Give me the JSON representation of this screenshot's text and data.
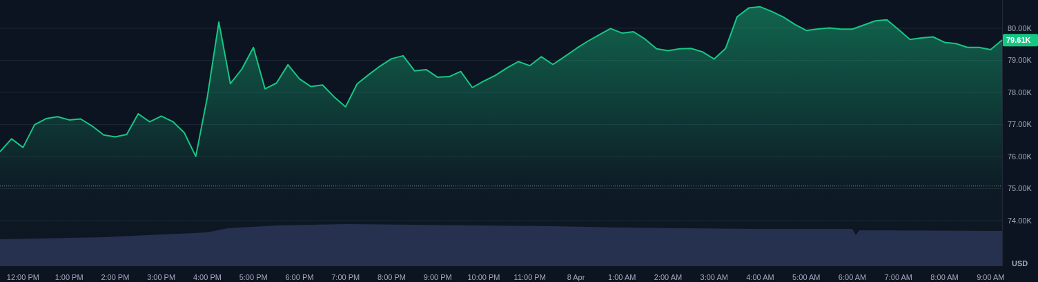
{
  "chart": {
    "chart_data": {
      "type": "area",
      "categories": [
        null,
        null,
        "12:00 PM",
        null,
        null,
        null,
        "1:00 PM",
        null,
        null,
        null,
        "2:00 PM",
        null,
        null,
        null,
        "3:00 PM",
        null,
        null,
        null,
        "4:00 PM",
        null,
        null,
        null,
        "5:00 PM",
        null,
        null,
        null,
        "6:00 PM",
        null,
        null,
        null,
        "7:00 PM",
        null,
        null,
        null,
        "8:00 PM",
        null,
        null,
        null,
        "9:00 PM",
        null,
        null,
        null,
        "10:00 PM",
        null,
        null,
        null,
        "11:00 PM",
        null,
        null,
        null,
        "8 Apr",
        null,
        null,
        null,
        "1:00 AM",
        null,
        null,
        null,
        "2:00 AM",
        null,
        null,
        null,
        "3:00 AM",
        null,
        null,
        null,
        "4:00 AM",
        null,
        null,
        null,
        "5:00 AM",
        null,
        null,
        null,
        "6:00 AM",
        null,
        null,
        null,
        "7:00 AM",
        null,
        null,
        null,
        "8:00 AM",
        null,
        null,
        null,
        "9:00 AM",
        null
      ],
      "series": [
        {
          "color": "#16c784",
          "values": [
            76.15,
            76.55,
            76.28,
            76.99,
            77.18,
            77.24,
            77.14,
            77.17,
            76.95,
            76.67,
            76.61,
            76.69,
            77.33,
            77.08,
            77.26,
            77.09,
            76.74,
            76.0,
            77.85,
            80.19,
            78.27,
            78.73,
            79.4,
            78.11,
            78.29,
            78.86,
            78.42,
            78.18,
            78.23,
            77.86,
            77.55,
            78.26,
            78.55,
            78.82,
            79.05,
            79.14,
            78.67,
            78.71,
            78.47,
            78.49,
            78.65,
            78.15,
            78.35,
            78.53,
            78.76,
            78.96,
            78.83,
            79.11,
            78.87,
            79.11,
            79.36,
            79.59,
            79.79,
            79.99,
            79.85,
            79.89,
            79.66,
            79.36,
            79.3,
            79.36,
            79.37,
            79.26,
            79.04,
            79.37,
            80.36,
            80.63,
            80.67,
            80.52,
            80.35,
            80.12,
            79.93,
            79.98,
            80.01,
            79.97,
            79.97,
            80.1,
            80.23,
            80.26,
            79.96,
            79.65,
            79.7,
            79.73,
            79.56,
            79.52,
            79.4,
            79.4,
            79.33,
            79.63
          ]
        }
      ],
      "ylim": [
        72.58,
        80.88
      ],
      "yticks": [
        {
          "value": 74,
          "label": "74.00K"
        },
        {
          "value": 75,
          "label": "75.00K"
        },
        {
          "value": 76,
          "label": "76.00K"
        },
        {
          "value": 77,
          "label": "77.00K"
        },
        {
          "value": 78,
          "label": "78.00K"
        },
        {
          "value": 79,
          "label": "79.00K"
        },
        {
          "value": 80,
          "label": "80.00K"
        }
      ],
      "grid": true,
      "ref_lines": [
        {
          "value": 75.08,
          "axis": "y"
        }
      ]
    },
    "current_price_label": "79.61K",
    "currency_label": "USD"
  }
}
